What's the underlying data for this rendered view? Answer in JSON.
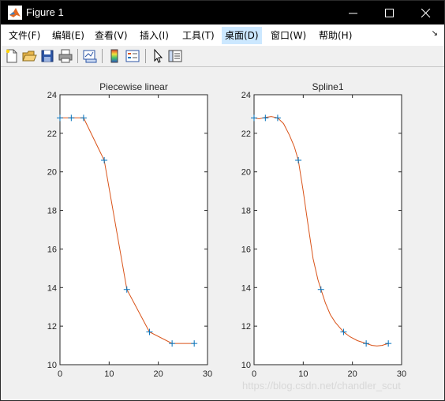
{
  "window": {
    "title": "Figure 1",
    "controls": [
      "minimize",
      "maximize",
      "close"
    ]
  },
  "menubar": {
    "items": [
      {
        "label": "文件(F)"
      },
      {
        "label": "编辑(E)"
      },
      {
        "label": "查看(V)"
      },
      {
        "label": "插入(I)"
      },
      {
        "label": "工具(T)"
      },
      {
        "label": "桌面(D)",
        "active": true
      },
      {
        "label": "窗口(W)"
      },
      {
        "label": "帮助(H)"
      }
    ],
    "overflow_icon": "dock-arrow-icon"
  },
  "toolbar": {
    "buttons": [
      "new-figure-icon",
      "open-file-icon",
      "save-icon",
      "print-icon",
      "link-plot-icon",
      "colorbar-icon",
      "legend-icon",
      "edit-plot-arrow-icon",
      "property-inspector-icon"
    ]
  },
  "colors": {
    "line": "#d95319",
    "marker": "#0072bd",
    "axes_background": "#ffffff",
    "figure_background": "#f0f0f0"
  },
  "chart_data": [
    {
      "type": "line",
      "title": "Piecewise linear",
      "xlim": [
        0,
        30
      ],
      "ylim": [
        10,
        24
      ],
      "xticks": [
        0,
        10,
        20,
        30
      ],
      "yticks": [
        10,
        12,
        14,
        16,
        18,
        20,
        22,
        24
      ],
      "points": {
        "x": [
          0,
          2.3,
          4.8,
          9,
          13.6,
          18.2,
          22.8,
          27.3
        ],
        "y": [
          22.8,
          22.8,
          22.8,
          20.6,
          13.9,
          11.7,
          11.1,
          11.1
        ]
      },
      "line_x": [
        0,
        2.3,
        4.8,
        9,
        13.6,
        18.2,
        22.8,
        27.3
      ],
      "line_y": [
        22.8,
        22.8,
        22.8,
        20.6,
        13.9,
        11.7,
        11.1,
        11.1
      ]
    },
    {
      "type": "line",
      "title": "Spline1",
      "xlim": [
        0,
        30
      ],
      "ylim": [
        10,
        24
      ],
      "xticks": [
        0,
        10,
        20,
        30
      ],
      "yticks": [
        10,
        12,
        14,
        16,
        18,
        20,
        22,
        24
      ],
      "points": {
        "x": [
          0,
          2.3,
          4.8,
          9,
          13.6,
          18.2,
          22.8,
          27.3
        ],
        "y": [
          22.8,
          22.8,
          22.8,
          20.6,
          13.9,
          11.7,
          11.1,
          11.1
        ]
      },
      "line_x": [
        0,
        1,
        2.3,
        3.5,
        4.8,
        6,
        7.2,
        8.2,
        9,
        10,
        11,
        12,
        13,
        13.6,
        14.5,
        15.5,
        16.5,
        17.5,
        18.2,
        19.5,
        21,
        22.8,
        24,
        25,
        26,
        27.3
      ],
      "line_y": [
        22.8,
        22.75,
        22.82,
        22.87,
        22.8,
        22.5,
        21.9,
        21.3,
        20.6,
        19.0,
        17.2,
        15.5,
        14.4,
        13.9,
        13.2,
        12.6,
        12.2,
        11.9,
        11.7,
        11.45,
        11.25,
        11.1,
        11.0,
        10.97,
        11.0,
        11.1
      ]
    }
  ],
  "watermark": "https://blog.csdn.net/chandler_scut"
}
